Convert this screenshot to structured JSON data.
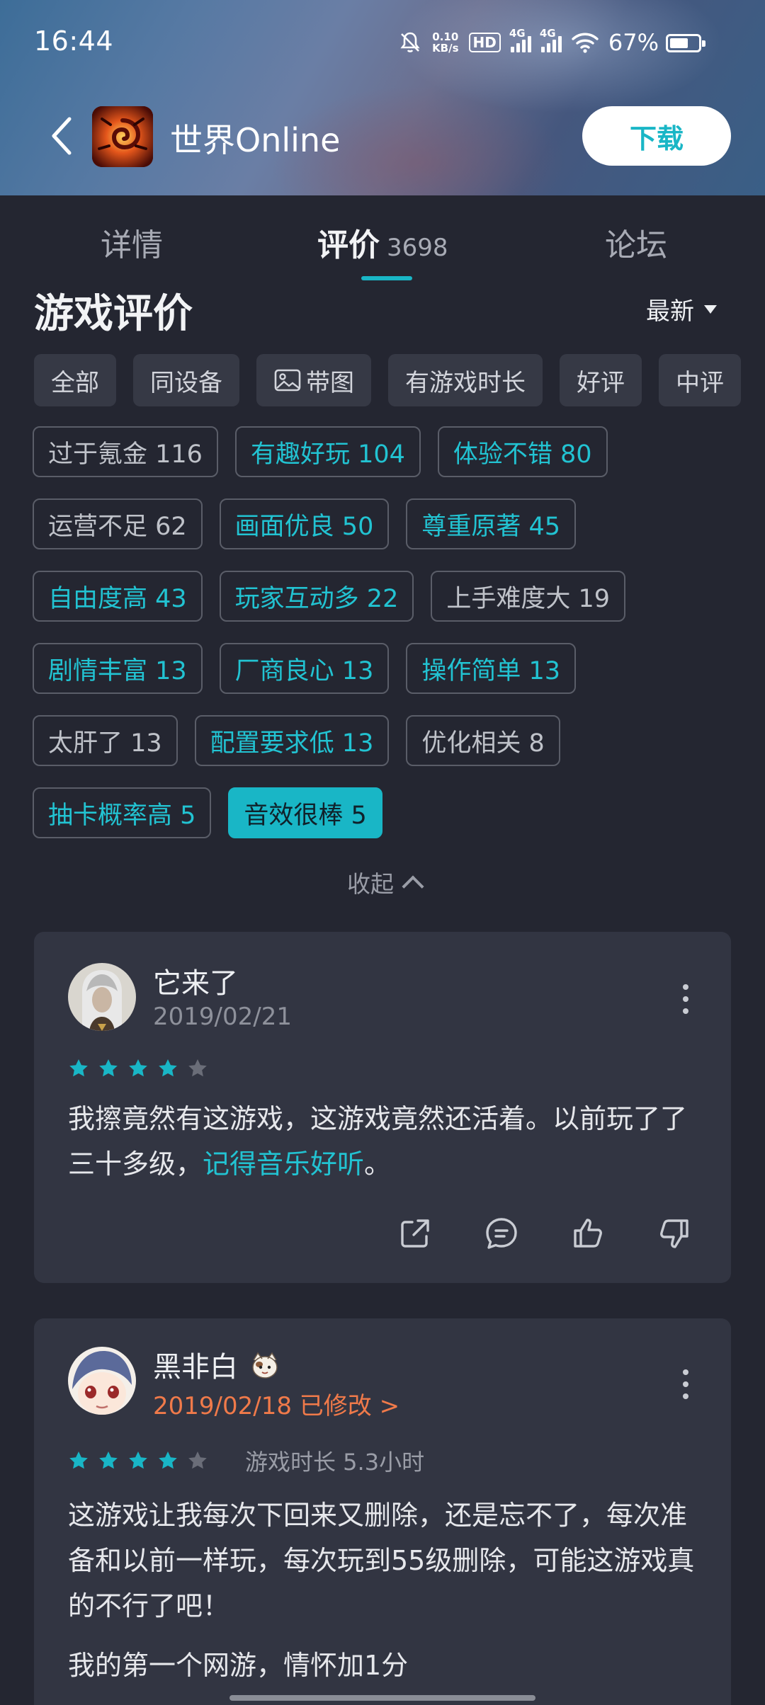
{
  "status_bar": {
    "time": "16:44",
    "net_speed_value": "0.10",
    "net_speed_unit": "KB/s",
    "hd_label": "HD",
    "sim1_label": "4G",
    "sim2_label": "4G",
    "battery_percent": "67%",
    "battery_level": 0.67,
    "icons": [
      "bell-off-icon",
      "hd-icon",
      "signal-icon",
      "signal-icon",
      "wifi-icon",
      "battery-icon"
    ]
  },
  "app_bar": {
    "back_icon": "chevron-left-icon",
    "app_name": "世界Online",
    "download_label": "下载"
  },
  "tabs": [
    {
      "label": "详情",
      "count": "",
      "active": false
    },
    {
      "label": "评价",
      "count": "3698",
      "active": true
    },
    {
      "label": "论坛",
      "count": "",
      "active": false
    }
  ],
  "section": {
    "title": "游戏评价",
    "sort_label": "最新"
  },
  "filters": [
    "全部",
    "同设备",
    "带图",
    "有游戏时长",
    "好评",
    "中评"
  ],
  "tags": [
    [
      {
        "label": "过于氪金 116",
        "kind": "neutral"
      },
      {
        "label": "有趣好玩 104",
        "kind": "pos"
      },
      {
        "label": "体验不错 80",
        "kind": "pos"
      }
    ],
    [
      {
        "label": "运营不足 62",
        "kind": "neutral"
      },
      {
        "label": "画面优良 50",
        "kind": "pos"
      },
      {
        "label": "尊重原著 45",
        "kind": "pos"
      }
    ],
    [
      {
        "label": "自由度高 43",
        "kind": "pos"
      },
      {
        "label": "玩家互动多 22",
        "kind": "pos"
      },
      {
        "label": "上手难度大 19",
        "kind": "neutral"
      }
    ],
    [
      {
        "label": "剧情丰富 13",
        "kind": "pos"
      },
      {
        "label": "厂商良心 13",
        "kind": "pos"
      },
      {
        "label": "操作简单 13",
        "kind": "pos"
      }
    ],
    [
      {
        "label": "太肝了 13",
        "kind": "neutral"
      },
      {
        "label": "配置要求低 13",
        "kind": "pos"
      },
      {
        "label": "优化相关 8",
        "kind": "neutral"
      }
    ],
    [
      {
        "label": "抽卡概率高 5",
        "kind": "pos"
      },
      {
        "label": "音效很棒 5",
        "kind": "sel"
      }
    ]
  ],
  "collapse_label": "收起",
  "reviews": [
    {
      "username": "它来了",
      "date": "2019/02/21",
      "rating": 4,
      "text_plain": "我擦竟然有这游戏，这游戏竟然还活着。以前玩了了三十多级，",
      "text_highlight": "记得音乐好听",
      "text_end": "。",
      "actions": [
        "share-icon",
        "comment-icon",
        "thumbs-up-icon",
        "thumbs-down-icon"
      ]
    },
    {
      "username": "黑非白",
      "date": "2019/02/18 已修改 >",
      "rating": 4,
      "playtime": "游戏时长 5.3小时",
      "text_para1": "这游戏让我每次下回来又删除，还是忘不了，每次准备和以前一样玩，每次玩到55级删除，可能这游戏真的不行了吧！",
      "text_para2": "我的第一个网游，情怀加1分"
    }
  ],
  "colors": {
    "accent": "#19b6c6",
    "background": "#242631",
    "card": "#323542",
    "edited": "#f07a4a"
  }
}
